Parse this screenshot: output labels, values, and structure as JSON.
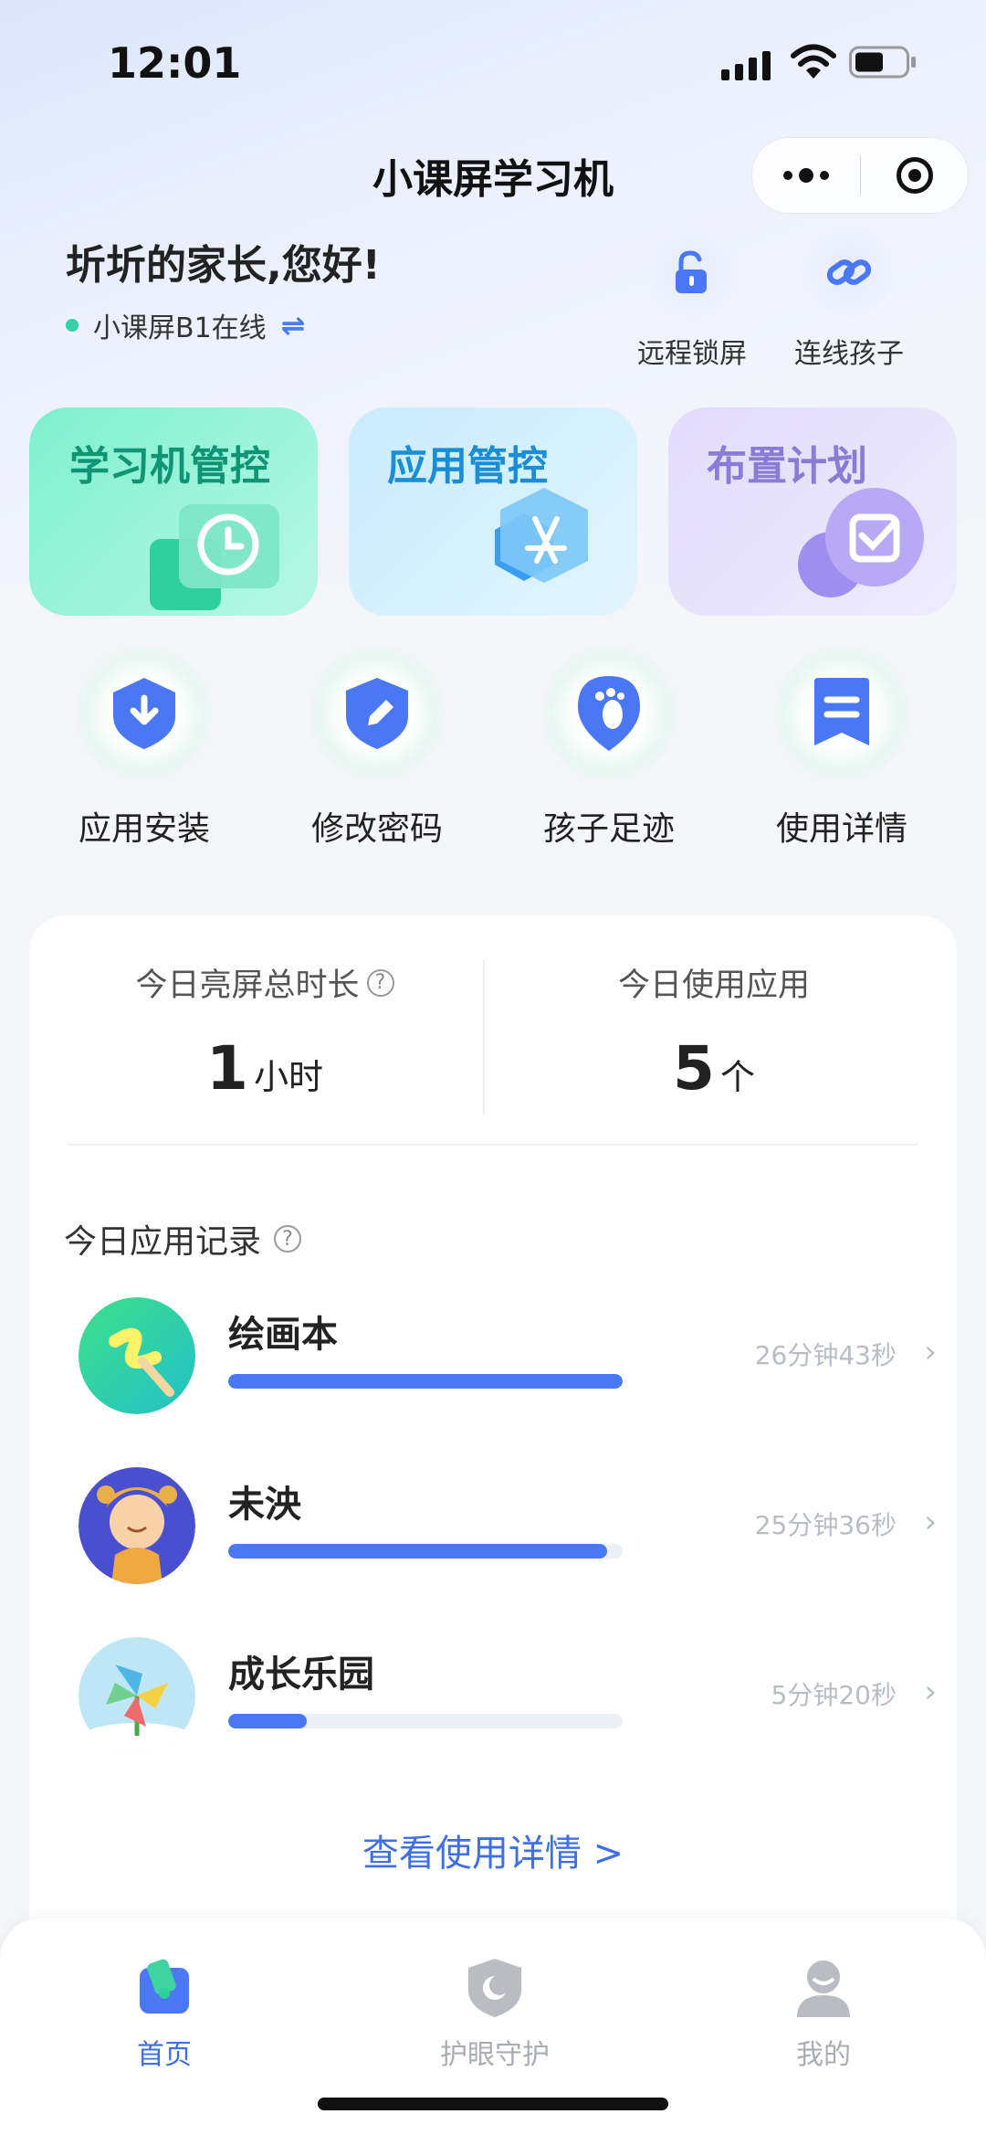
{
  "status": {
    "time": "12:01"
  },
  "header": {
    "title": "小课屏学习机"
  },
  "greeting": "圻圻的家长,您好!",
  "device": {
    "status": "小课屏B1在线",
    "swap_icon": "⇌"
  },
  "quick_actions": [
    {
      "label": "远程锁屏",
      "icon": "unlock-icon"
    },
    {
      "label": "连线孩子",
      "icon": "link-icon"
    }
  ],
  "cards": [
    {
      "label": "学习机管控",
      "icon": "clock-icon",
      "color": "#109476"
    },
    {
      "label": "应用管控",
      "icon": "appstore-icon",
      "color": "#1a8cd8"
    },
    {
      "label": "布置计划",
      "icon": "checkbox-icon",
      "color": "#8a7bd6"
    }
  ],
  "tools": [
    {
      "label": "应用安装",
      "icon": "install-shield-icon"
    },
    {
      "label": "修改密码",
      "icon": "edit-shield-icon"
    },
    {
      "label": "孩子足迹",
      "icon": "footprint-icon"
    },
    {
      "label": "使用详情",
      "icon": "details-icon"
    }
  ],
  "stats": {
    "screen_time": {
      "title": "今日亮屏总时长",
      "value": "1",
      "unit": "小时",
      "help": "?"
    },
    "apps_used": {
      "title": "今日使用应用",
      "value": "5",
      "unit": "个"
    }
  },
  "records": {
    "title": "今日应用记录",
    "help": "?",
    "items": [
      {
        "name": "绘画本",
        "duration": "26分钟43秒",
        "progress": 1.0
      },
      {
        "name": "未泱",
        "duration": "25分钟36秒",
        "progress": 0.96
      },
      {
        "name": "成长乐园",
        "duration": "5分钟20秒",
        "progress": 0.2
      }
    ],
    "more": "查看使用详情 >"
  },
  "tabs": [
    {
      "label": "首页",
      "icon": "home-icon",
      "active": true
    },
    {
      "label": "护眼守护",
      "icon": "eye-shield-icon",
      "active": false
    },
    {
      "label": "我的",
      "icon": "profile-icon",
      "active": false
    }
  ],
  "colors": {
    "accent": "#3f6fe6",
    "bar": "#4a78f5",
    "online": "#37d3a6"
  }
}
